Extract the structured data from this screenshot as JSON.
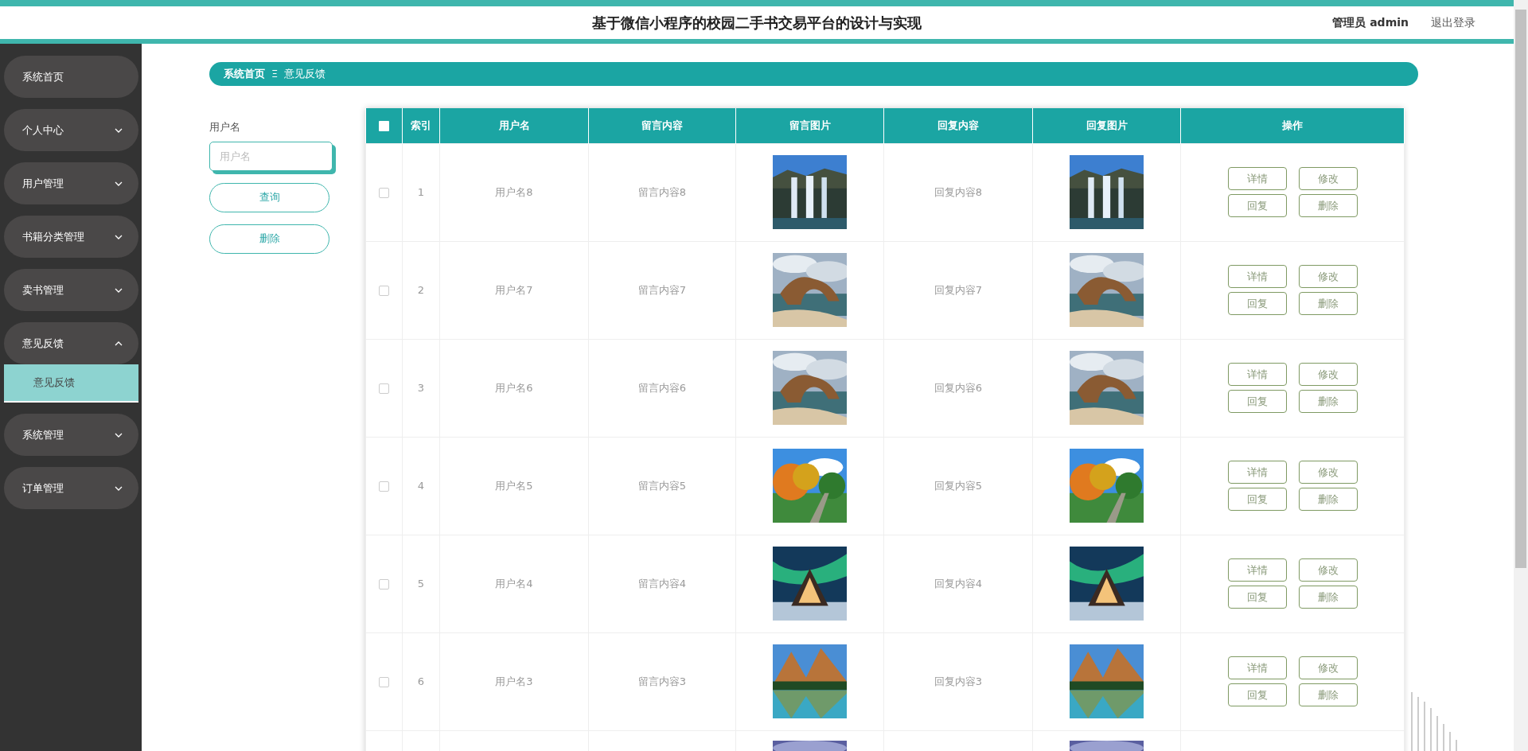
{
  "header": {
    "title": "基于微信小程序的校园二手书交易平台的设计与实现",
    "user": "管理员 admin",
    "logout": "退出登录"
  },
  "sidebar": {
    "items": [
      {
        "label": "系统首页",
        "kind": "link"
      },
      {
        "label": "个人中心",
        "kind": "menu",
        "expanded": false
      },
      {
        "label": "用户管理",
        "kind": "menu",
        "expanded": false
      },
      {
        "label": "书籍分类管理",
        "kind": "menu",
        "expanded": false
      },
      {
        "label": "卖书管理",
        "kind": "menu",
        "expanded": false
      },
      {
        "label": "意见反馈",
        "kind": "menu",
        "expanded": true,
        "children": [
          {
            "label": "意见反馈",
            "selected": true
          }
        ]
      },
      {
        "label": "系统管理",
        "kind": "menu",
        "expanded": false
      },
      {
        "label": "订单管理",
        "kind": "menu",
        "expanded": false
      }
    ]
  },
  "breadcrumb": {
    "items": [
      "系统首页",
      "意见反馈"
    ],
    "separator": "Ξ"
  },
  "search": {
    "label": "用户名",
    "placeholder": "用户名",
    "buttons": [
      "查询",
      "删除"
    ]
  },
  "table": {
    "select_all_checked": false,
    "columns": [
      "索引",
      "用户名",
      "留言内容",
      "留言图片",
      "回复内容",
      "回复图片",
      "操作"
    ],
    "rows": [
      {
        "kind": "full",
        "checked": false,
        "index": "1",
        "username": "用户名8",
        "message": "留言内容8",
        "reply": "回复内容8",
        "actions": [
          "详情",
          "修改",
          "回复",
          "删除"
        ]
      },
      {
        "kind": "full",
        "checked": false,
        "index": "2",
        "username": "用户名7",
        "message": "留言内容7",
        "reply": "回复内容7",
        "actions": [
          "详情",
          "修改",
          "回复",
          "删除"
        ]
      },
      {
        "kind": "full",
        "checked": false,
        "index": "3",
        "username": "用户名6",
        "message": "留言内容6",
        "reply": "回复内容6",
        "actions": [
          "详情",
          "修改",
          "回复",
          "删除"
        ]
      },
      {
        "kind": "full",
        "checked": false,
        "index": "4",
        "username": "用户名5",
        "message": "留言内容5",
        "reply": "回复内容5",
        "actions": [
          "详情",
          "修改",
          "回复",
          "删除"
        ]
      },
      {
        "kind": "full",
        "checked": false,
        "index": "5",
        "username": "用户名4",
        "message": "留言内容4",
        "reply": "回复内容4",
        "actions": [
          "详情",
          "修改",
          "回复",
          "删除"
        ]
      },
      {
        "kind": "full",
        "checked": false,
        "index": "6",
        "username": "用户名3",
        "message": "留言内容3",
        "reply": "回复内容3",
        "actions": [
          "详情",
          "修改",
          "回复",
          "删除"
        ]
      },
      {
        "kind": "partial"
      }
    ]
  }
}
